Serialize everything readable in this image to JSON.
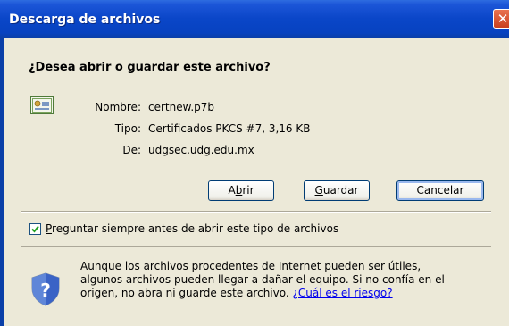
{
  "window": {
    "title": "Descarga de archivos"
  },
  "question": "¿Desea abrir o guardar este archivo?",
  "file": {
    "name_label": "Nombre:",
    "name": "certnew.p7b",
    "type_label": "Tipo:",
    "type": "Certificados PKCS #7, 3,16 KB",
    "from_label": "De:",
    "from": "udgsec.udg.edu.mx"
  },
  "buttons": {
    "open_hotkey": "b",
    "open_pre": "A",
    "open_post": "rir",
    "save_hotkey": "G",
    "save_post": "uardar",
    "cancel": "Cancelar"
  },
  "checkbox": {
    "checked": true,
    "hotkey": "P",
    "label_rest": "reguntar siempre antes de abrir este tipo de archivos"
  },
  "warning": {
    "text": "Aunque los archivos procedentes de Internet pueden ser útiles, algunos archivos pueden llegar a dañar el equipo. Si no confía en el origen, no abra ni guarde este archivo.",
    "link": "¿Cuál es el riesgo?"
  },
  "icons": [
    "close-icon",
    "certificate-icon",
    "checkmark-icon",
    "security-shield-icon"
  ],
  "colors": {
    "titlebar": "#0A46C8",
    "dialog_bg": "#ECE9D8",
    "close_button": "#D75A33",
    "link": "#0000EE"
  }
}
